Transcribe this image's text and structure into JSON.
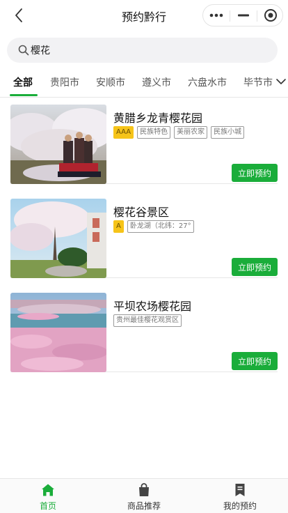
{
  "header": {
    "title": "预约黔行"
  },
  "search": {
    "value": "樱花",
    "placeholder": ""
  },
  "tabs": [
    "全部",
    "贵阳市",
    "安顺市",
    "遵义市",
    "六盘水市",
    "毕节市"
  ],
  "spots": [
    {
      "name": "黄腊乡龙青樱花园",
      "tags": [
        "AAA",
        "民族特色",
        "美丽农家",
        "民族小城"
      ],
      "button": "立即预约"
    },
    {
      "name": "樱花谷景区",
      "tags": [
        "A",
        "卧龙湖（北纬：27°"
      ],
      "button": "立即预约"
    },
    {
      "name": "平坝农场樱花园",
      "tags": [
        "贵州最佳樱花观赏区"
      ],
      "button": "立即预约"
    }
  ],
  "bottom_nav": [
    {
      "label": "首页",
      "icon": "home-icon",
      "active": true
    },
    {
      "label": "商品推荐",
      "icon": "shopping-bag-icon",
      "active": false
    },
    {
      "label": "我的预约",
      "icon": "bookmark-icon",
      "active": false
    }
  ],
  "colors": {
    "accent": "#1aad3a",
    "level_badge": "#f6c419"
  }
}
